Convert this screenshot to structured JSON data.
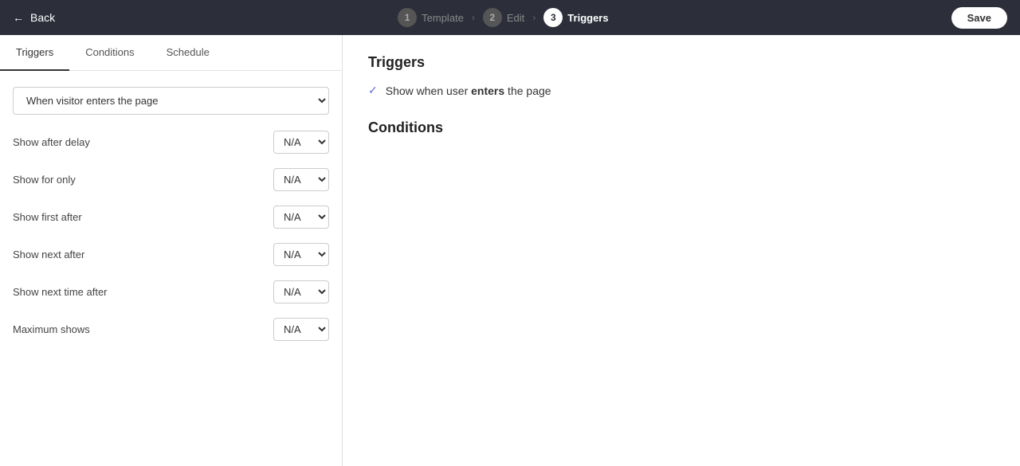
{
  "header": {
    "back_label": "Back",
    "steps": [
      {
        "num": "1",
        "label": "Template",
        "state": "inactive"
      },
      {
        "num": "2",
        "label": "Edit",
        "state": "inactive"
      },
      {
        "num": "3",
        "label": "Triggers",
        "state": "active"
      }
    ],
    "save_label": "Save"
  },
  "left_panel": {
    "tabs": [
      {
        "id": "triggers",
        "label": "Triggers",
        "active": true
      },
      {
        "id": "conditions",
        "label": "Conditions",
        "active": false
      },
      {
        "id": "schedule",
        "label": "Schedule",
        "active": false
      }
    ],
    "trigger_select": {
      "value": "When visitor enters the page",
      "options": [
        "When visitor enters the page"
      ]
    },
    "fields": [
      {
        "id": "show_after_delay",
        "label": "Show after delay",
        "value": "N/A"
      },
      {
        "id": "show_for_only",
        "label": "Show for only",
        "value": "N/A"
      },
      {
        "id": "show_first_after",
        "label": "Show first after",
        "value": "N/A"
      },
      {
        "id": "show_next_after",
        "label": "Show next after",
        "value": "N/A"
      },
      {
        "id": "show_next_time_after",
        "label": "Show next time after",
        "value": "N/A"
      },
      {
        "id": "maximum_shows",
        "label": "Maximum shows",
        "value": "N/A"
      }
    ]
  },
  "right_panel": {
    "triggers_title": "Triggers",
    "trigger_description_prefix": "Show when user ",
    "trigger_description_bold": "enters",
    "trigger_description_suffix": " the page",
    "conditions_title": "Conditions"
  }
}
